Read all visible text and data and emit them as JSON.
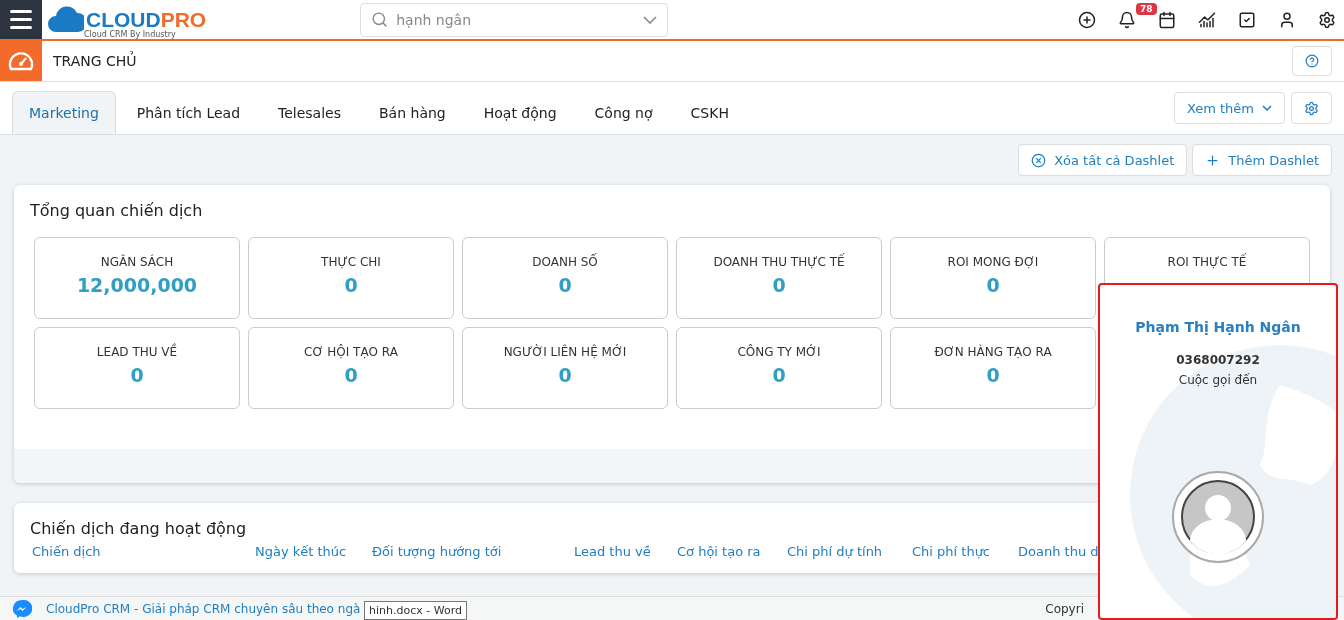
{
  "header": {
    "logo": {
      "brand_a": "CLOUD",
      "brand_b": "PRO",
      "tagline": "Cloud CRM By Industry"
    },
    "search": {
      "value": "hạnh ngân"
    },
    "notification_count": "78"
  },
  "breadcrumb": {
    "title": "TRANG CHỦ"
  },
  "tabs": [
    {
      "label": "Marketing",
      "selected": true
    },
    {
      "label": "Phân tích Lead",
      "selected": false
    },
    {
      "label": "Telesales",
      "selected": false
    },
    {
      "label": "Bán hàng",
      "selected": false
    },
    {
      "label": "Hoạt động",
      "selected": false
    },
    {
      "label": "Công nợ",
      "selected": false
    },
    {
      "label": "CSKH",
      "selected": false
    }
  ],
  "more_button": "Xem thêm",
  "actions": {
    "clear": "Xóa tất cả Dashlet",
    "add": "Thêm Dashlet"
  },
  "overview": {
    "title": "Tổng quan chiến dịch",
    "rows": [
      [
        {
          "label": "NGÂN SÁCH",
          "value": "12,000,000"
        },
        {
          "label": "THỰC CHI",
          "value": "0"
        },
        {
          "label": "DOANH SỐ",
          "value": "0"
        },
        {
          "label": "DOANH THU THỰC TẾ",
          "value": "0"
        },
        {
          "label": "ROI MONG ĐỢI",
          "value": "0"
        },
        {
          "label": "ROI THỰC TẾ"
        }
      ],
      [
        {
          "label": "LEAD THU VỀ",
          "value": "0"
        },
        {
          "label": "CƠ HỘI TẠO RA",
          "value": "0"
        },
        {
          "label": "NGƯỜI LIÊN HỆ MỚI",
          "value": "0"
        },
        {
          "label": "CÔNG TY MỚI",
          "value": "0"
        },
        {
          "label": "ĐƠN HÀNG TẠO RA",
          "value": "0"
        }
      ]
    ]
  },
  "active_campaigns": {
    "title": "Chiến dịch đang hoạt động",
    "columns": [
      "Chiến dịch",
      "Ngày kết thúc",
      "Đối tượng hướng tới",
      "Lead thu về",
      "Cơ hội tạo ra",
      "Chi phí dự tính",
      "Chi phí thực",
      "Doanh thu d"
    ]
  },
  "footer": {
    "text": "CloudPro CRM - Giải pháp CRM chuyên sâu theo ngà",
    "copyright": "Copyri"
  },
  "tooltip": "hinh.docx - Word",
  "call_popup": {
    "name": "Phạm Thị Hạnh Ngân",
    "phone": "0368007292",
    "status": "Cuộc gọi đến"
  }
}
